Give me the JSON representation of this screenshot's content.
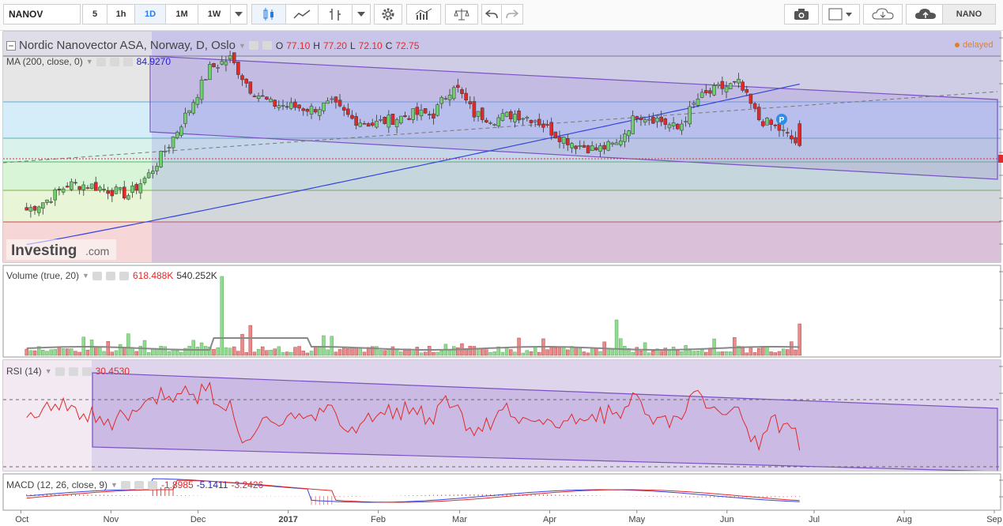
{
  "toolbar": {
    "symbol": "NANOV",
    "intervals": [
      "5",
      "1h",
      "1D",
      "1M",
      "1W"
    ],
    "active_interval": "1D",
    "nano_label": "NANO"
  },
  "header": {
    "title": "Nordic Nanovector ASA, Norway, D, Oslo",
    "o_label": "O",
    "o": "77.10",
    "h_label": "H",
    "h": "77.20",
    "l_label": "L",
    "l": "72.10",
    "c_label": "C",
    "c": "72.75",
    "delayed": "delayed"
  },
  "watermark": {
    "brand": "Investing",
    "suffix": ".com"
  },
  "indicators": {
    "ma": {
      "label": "MA (200, close, 0)",
      "value": "84.9270"
    },
    "volume": {
      "label": "Volume (true, 20)",
      "value1": "618.488K",
      "value2": "540.252K"
    },
    "rsi": {
      "label": "RSI (14)",
      "value": "30.4530"
    },
    "macd": {
      "label": "MACD (12, 26, close, 9)",
      "value1": "-1.8985",
      "value2": "-5.1411",
      "value3": "-3.2426"
    }
  },
  "marker": {
    "label": "P"
  },
  "colors": {
    "up": "#6fcf6f",
    "down": "#e02a2a",
    "ma": "#3344dd",
    "rsi": "#e02a2a",
    "channel": "#8a5fc9",
    "accent": "#2c7be5"
  },
  "chart_data": {
    "type": "candlestick",
    "x_ticks": [
      "Oct",
      "Nov",
      "Dec",
      "2017",
      "Feb",
      "Mar",
      "Apr",
      "May",
      "Jun",
      "Jul",
      "Aug",
      "Sep"
    ],
    "close_series": [
      {
        "date": "2016-10-03",
        "close": 60
      },
      {
        "date": "2016-10-10",
        "close": 62
      },
      {
        "date": "2016-10-17",
        "close": 65
      },
      {
        "date": "2016-10-24",
        "close": 65
      },
      {
        "date": "2016-10-31",
        "close": 64
      },
      {
        "date": "2016-11-07",
        "close": 63
      },
      {
        "date": "2016-11-14",
        "close": 67
      },
      {
        "date": "2016-11-21",
        "close": 73
      },
      {
        "date": "2016-11-28",
        "close": 80
      },
      {
        "date": "2016-12-05",
        "close": 88
      },
      {
        "date": "2016-12-12",
        "close": 90
      },
      {
        "date": "2016-12-19",
        "close": 84
      },
      {
        "date": "2016-12-26",
        "close": 81
      },
      {
        "date": "2017-01-09",
        "close": 80
      },
      {
        "date": "2017-01-16",
        "close": 81
      },
      {
        "date": "2017-01-23",
        "close": 78
      },
      {
        "date": "2017-01-30",
        "close": 77
      },
      {
        "date": "2017-02-06",
        "close": 78
      },
      {
        "date": "2017-02-13",
        "close": 79
      },
      {
        "date": "2017-02-20",
        "close": 79
      },
      {
        "date": "2017-02-27",
        "close": 85
      },
      {
        "date": "2017-03-06",
        "close": 79
      },
      {
        "date": "2017-03-13",
        "close": 78
      },
      {
        "date": "2017-03-20",
        "close": 79
      },
      {
        "date": "2017-03-27",
        "close": 78
      },
      {
        "date": "2017-04-03",
        "close": 75
      },
      {
        "date": "2017-04-10",
        "close": 73
      },
      {
        "date": "2017-04-17",
        "close": 72
      },
      {
        "date": "2017-04-24",
        "close": 73
      },
      {
        "date": "2017-05-01",
        "close": 79
      },
      {
        "date": "2017-05-08",
        "close": 78
      },
      {
        "date": "2017-05-15",
        "close": 76
      },
      {
        "date": "2017-05-22",
        "close": 82
      },
      {
        "date": "2017-05-29",
        "close": 84
      },
      {
        "date": "2017-06-05",
        "close": 85
      },
      {
        "date": "2017-06-12",
        "close": 78
      },
      {
        "date": "2017-06-19",
        "close": 76
      },
      {
        "date": "2017-06-26",
        "close": 72.75
      }
    ],
    "ylim": [
      50,
      95
    ],
    "ma_value": 84.927,
    "rsi_last": 30.453
  }
}
